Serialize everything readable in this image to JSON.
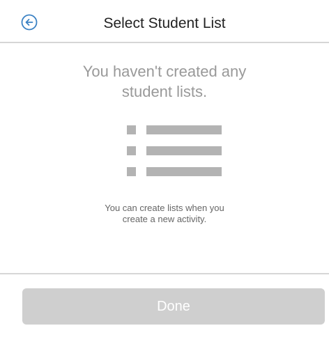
{
  "header": {
    "title": "Select Student List",
    "back_icon": "arrow-left-circle-icon",
    "accent_color": "#3b82c4"
  },
  "empty_state": {
    "title": "You haven't created any\nstudent lists.",
    "illustration_icon": "list-icon",
    "hint": "You can create lists when you\ncreate a new activity."
  },
  "footer": {
    "done_label": "Done"
  },
  "colors": {
    "divider": "#d6d6d6",
    "muted_text": "#999999",
    "illustration": "#b3b3b3",
    "disabled_button": "#cfcfcf"
  }
}
